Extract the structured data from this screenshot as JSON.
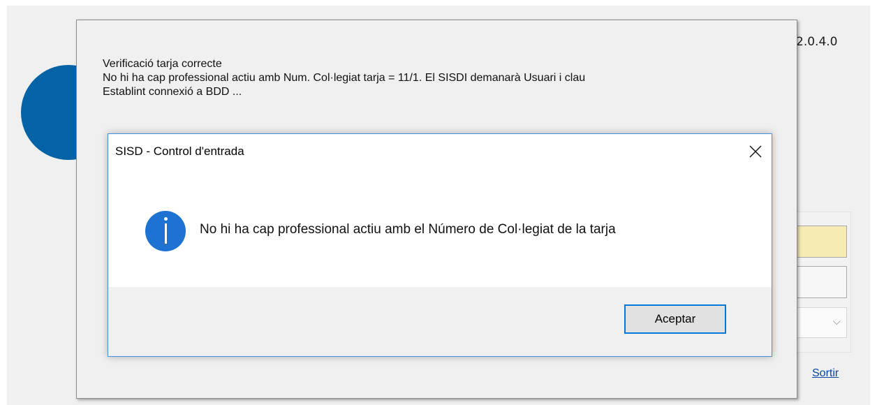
{
  "main_window": {
    "version": "2.0.4.0",
    "exit_link": "Sortir",
    "colors": {
      "brand_circle": "#0463a6",
      "highlight_field": "#f5ebb3"
    }
  },
  "progress": {
    "log_lines": [
      "Verificació tarja correcte",
      "No hi ha cap professional actiu amb Num. Col·legiat tarja = 11/1. El SISDI demanarà Usuari i clau",
      "Establint connexió a BDD ..."
    ]
  },
  "dialog": {
    "title": "SISD - Control d'entrada",
    "message": "No hi ha cap professional actiu amb el Número de Col·legiat de la tarja",
    "ok_label": "Aceptar",
    "icons": {
      "close": "close-icon",
      "info": "info-icon"
    },
    "colors": {
      "info_icon": "#1e73d2",
      "focus_border": "#0078d7"
    }
  }
}
